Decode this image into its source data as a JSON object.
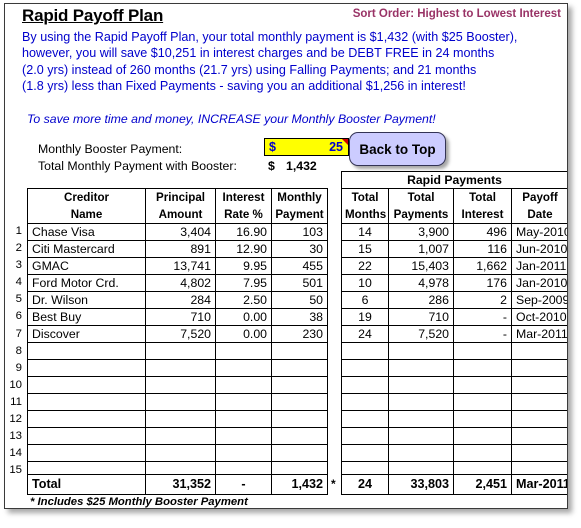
{
  "window": {
    "title": "Rapid Payoff Plan",
    "sort_order": "Sort Order: Highest to Lowest Interest"
  },
  "intro": {
    "line1": "By using the Rapid Payoff Plan, your total monthly payment is $1,432 (with $25 Booster),",
    "line2": "however, you will save $10,251 in interest charges and be DEBT FREE in 24 months",
    "line3": "(2.0 yrs) instead of 260 months (21.7 yrs) using Falling Payments; and 21 months",
    "line4": "(1.8 yrs) less than Fixed Payments - saving you an additional $1,256 in interest!",
    "note": "To save more time and money, INCREASE your Monthly Booster Payment!"
  },
  "booster": {
    "label": "Monthly Booster Payment:",
    "currency": "$",
    "value": "25",
    "total_label": "Total Monthly Payment with Booster:",
    "total_currency": "$",
    "total_value": "1,432",
    "back_to_top": "Back to Top"
  },
  "left_table": {
    "headers": [
      [
        "Creditor",
        "Name"
      ],
      [
        "Principal",
        "Amount"
      ],
      [
        "Interest",
        "Rate %"
      ],
      [
        "Monthly",
        "Payment"
      ]
    ],
    "rows": [
      [
        "Chase Visa",
        "3,404",
        "16.90",
        "103"
      ],
      [
        "Citi Mastercard",
        "891",
        "12.90",
        "30"
      ],
      [
        "GMAC",
        "13,741",
        "9.95",
        "455"
      ],
      [
        "Ford Motor Crd.",
        "4,802",
        "7.95",
        "501"
      ],
      [
        "Dr. Wilson",
        "284",
        "2.50",
        "50"
      ],
      [
        "Best Buy",
        "710",
        "0.00",
        "38"
      ],
      [
        "Discover",
        "7,520",
        "0.00",
        "230"
      ],
      [
        "",
        "",
        "",
        ""
      ],
      [
        "",
        "",
        "",
        ""
      ],
      [
        "",
        "",
        "",
        ""
      ],
      [
        "",
        "",
        "",
        ""
      ],
      [
        "",
        "",
        "",
        ""
      ],
      [
        "",
        "",
        "",
        ""
      ],
      [
        "",
        "",
        "",
        ""
      ],
      [
        "",
        "",
        "",
        ""
      ]
    ],
    "total": [
      "Total",
      "31,352",
      "-",
      "1,432"
    ]
  },
  "right_table": {
    "band_title": "Rapid Payments",
    "headers": [
      [
        "Total",
        "Months"
      ],
      [
        "Total",
        "Payments"
      ],
      [
        "Total",
        "Interest"
      ],
      [
        "Payoff",
        "Date"
      ]
    ],
    "rows": [
      [
        "14",
        "3,900",
        "496",
        "May-2010"
      ],
      [
        "15",
        "1,007",
        "116",
        "Jun-2010"
      ],
      [
        "22",
        "15,403",
        "1,662",
        "Jan-2011"
      ],
      [
        "10",
        "4,978",
        "176",
        "Jan-2010"
      ],
      [
        "6",
        "286",
        "2",
        "Sep-2009"
      ],
      [
        "19",
        "710",
        "-",
        "Oct-2010"
      ],
      [
        "24",
        "7,520",
        "-",
        "Mar-2011"
      ],
      [
        "",
        "",
        "",
        ""
      ],
      [
        "",
        "",
        "",
        ""
      ],
      [
        "",
        "",
        "",
        ""
      ],
      [
        "",
        "",
        "",
        ""
      ],
      [
        "",
        "",
        "",
        ""
      ],
      [
        "",
        "",
        "",
        ""
      ],
      [
        "",
        "",
        "",
        ""
      ],
      [
        "",
        "",
        "",
        ""
      ]
    ],
    "total": [
      "24",
      "33,803",
      "2,451",
      "Mar-2011"
    ]
  },
  "row_numbers": [
    "1",
    "2",
    "3",
    "4",
    "5",
    "6",
    "7",
    "8",
    "9",
    "10",
    "11",
    "12",
    "13",
    "14",
    "15"
  ],
  "footnote": {
    "star": "*",
    "text": "* Includes $25 Monthly Booster Payment"
  },
  "colors": {
    "link_blue": "#0000CC",
    "sort_maroon": "#993366",
    "input_yellow": "#FFFF00",
    "button_lavender": "#CCCCFF"
  }
}
